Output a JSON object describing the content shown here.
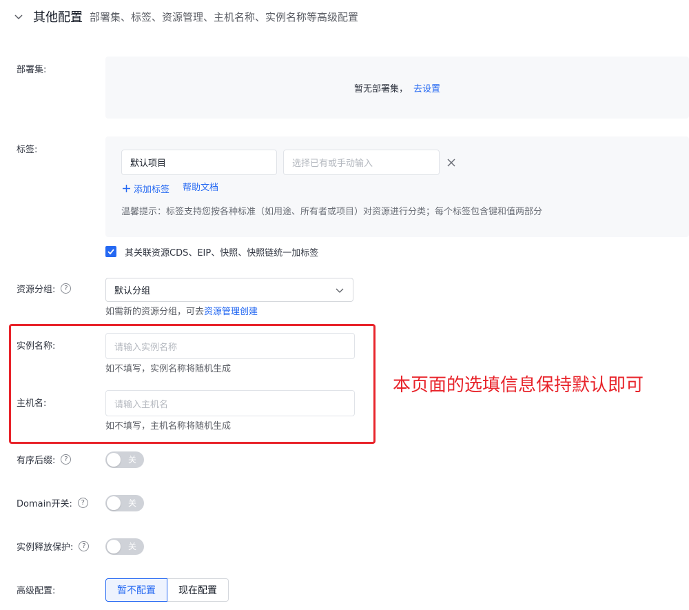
{
  "section": {
    "title": "其他配置",
    "subtitle": "部署集、标签、资源管理、主机名称、实例名称等高级配置",
    "icon": "chevron-down-icon"
  },
  "deployment": {
    "label": "部署集:",
    "empty_text": "暂无部署集，",
    "link": "去设置"
  },
  "tags": {
    "label": "标签:",
    "key_value": "默认项目",
    "value_placeholder": "选择已有或手动输入",
    "add_tag": "添加标签",
    "help_doc": "帮助文档",
    "tip": "温馨提示：标签支持您按各种标准（如用途、所有者或项目）对资源进行分类；每个标签包含键和值两部分"
  },
  "related_checkbox": {
    "label": "其关联资源CDS、EIP、快照、快照链统一加标签",
    "checked": true
  },
  "resource_group": {
    "label": "资源分组:",
    "selected": "默认分组",
    "hint_prefix": "如需新的资源分组，可去",
    "hint_link": "资源管理创建"
  },
  "instance_name": {
    "label": "实例名称:",
    "placeholder": "请输入实例名称",
    "hint": "如不填写，实例名称将随机生成"
  },
  "host_name": {
    "label": "主机名:",
    "placeholder": "请输入主机名",
    "hint": "如不填写，主机名称将随机生成"
  },
  "ordered_suffix": {
    "label": "有序后缀:",
    "state": "关"
  },
  "domain_switch": {
    "label": "Domain开关:",
    "state": "关"
  },
  "release_protect": {
    "label": "实例释放保护:",
    "state": "关"
  },
  "advanced": {
    "label": "高级配置:",
    "options": [
      "暂不配置",
      "现在配置"
    ],
    "selected": "暂不配置"
  },
  "annotation": {
    "text": "本页面的选填信息保持默认即可"
  },
  "colors": {
    "accent": "#2468f2",
    "annotation_red": "#e8242b",
    "panel_bg": "#f7f8fa"
  }
}
